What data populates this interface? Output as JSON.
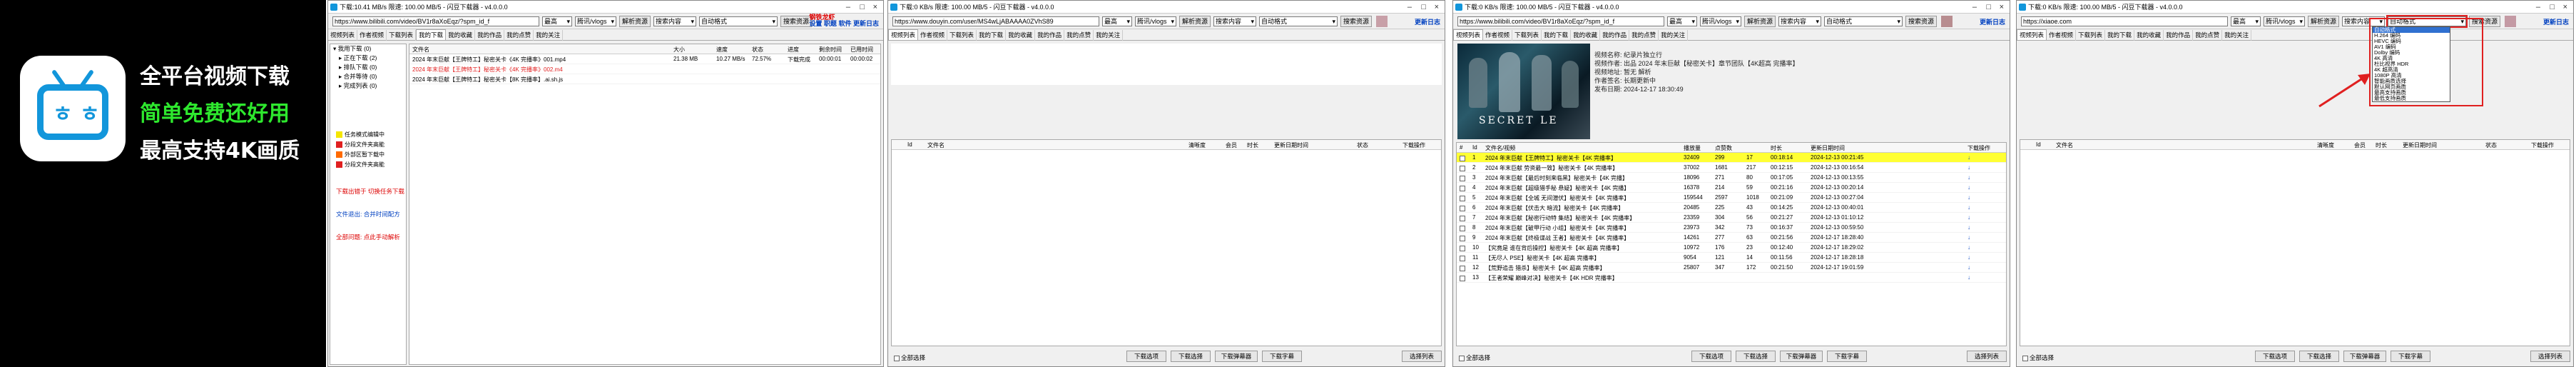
{
  "promo": {
    "line1": "全平台视频下载",
    "line2": "简单免费还好用",
    "line3": "最高支持4K画质",
    "colors": {
      "bg": "#000000",
      "white": "#ffffff",
      "green": "#2ee82e",
      "logo_blue": "#1296db"
    }
  },
  "app": {
    "title": "下载:10.41 MB/s 限速: 100.00 MB/5 - 闪豆下载器 - v4.0.0.0",
    "title_idle": "下载:0 KB/s 限速: 100.00 MB/5 - 闪豆下载器 - v4.0.0.0",
    "url_b": "https://www.bilibili.com/video/BV1r8aXoEqz/?spm_id_f",
    "url_d": "https://www.douyin.com/user/MS4wLjABAAAA0ZVhS89",
    "url_c": "https://www.bilibili.com/video/BV1r8aXoEqz/?spm_id_f",
    "url_e": "https://xiaoe.com",
    "sel_quality": "最高",
    "sel_mode": "腾讯/vlogs",
    "btn_parse": "解析资源",
    "sel_site": "搜索内容",
    "sel_format": "自动格式",
    "btn_search": "搜索资源",
    "user_name": "钢铁龙虾",
    "links": [
      "设置",
      "职题",
      "软件",
      "更新日志"
    ],
    "tabs": [
      "视频列表",
      "作者视频",
      "下载列表",
      "我的下载",
      "我的收藏",
      "我的作品",
      "我的点赞",
      "我的关注"
    ]
  },
  "win_a": {
    "tree": [
      "我用下载 (0)",
      "正在下载 (2)",
      "排队下载 (0)",
      "合并等待 (0)",
      "完成列表 (0)"
    ],
    "headers": [
      "文件名",
      "大小",
      "速度",
      "状态",
      "进度",
      "剩余时间",
      "已用时间"
    ],
    "rows": [
      {
        "name": "2024 年末巨献【王牌特工】秘密关卡《4K 完播率》001.mp4",
        "size": "21.38 MB",
        "speed": "10.27 MB/s",
        "progress": "72.57%",
        "status": "下载完成",
        "remain": "00:00:01",
        "used": "00:00:02"
      },
      {
        "name": "2024 年末巨献【王牌特工】秘密关卡《4K 完播率》002.m4",
        "size": "",
        "speed": "",
        "progress": "",
        "status": "",
        "remain": "",
        "used": ""
      },
      {
        "name": "2024 年末巨献【王牌特工】秘密关卡【8K 完播率】.ai.sh.js",
        "size": "",
        "speed": "",
        "progress": "",
        "status": "",
        "remain": "",
        "used": ""
      }
    ],
    "legend": [
      {
        "label": "任务模式编辑中",
        "color": "#f5e600"
      },
      {
        "label": "分段文件夹高能",
        "color": "#e02020"
      },
      {
        "label": "外部区暂下载中",
        "color": "#ff6a00"
      },
      {
        "label": "分段文件夹高能",
        "color": "#e02020"
      }
    ],
    "notes": [
      "下载出错于 切换任务下载",
      "文件退出: 合并时间配方",
      "全部问题: 点此手动解析"
    ]
  },
  "win_b": {
    "headers": [
      "Id",
      "文件名",
      "清晰度",
      "会员",
      "时长",
      "更新日期时间",
      "状态",
      "下载操作"
    ],
    "select_all": "全部选择",
    "buttons": [
      "下载选项",
      "下载选择",
      "下载弹幕器",
      "下载字幕",
      "选择列表"
    ]
  },
  "win_c": {
    "info": [
      "视频名称: 纪录片独立行",
      "视频作者: 出品 2024 年末巨献【秘密关卡】章节团队【4K超高 完播率】",
      "视频地址: 暂无 解析",
      "作者签名: 长期更新中",
      "发布日期: 2024-12-17 18:30:49"
    ],
    "poster_text": "SECRET LE",
    "headers": [
      "#",
      "Id",
      "文件名/视频",
      "播放量",
      "点赞数",
      "时长",
      "更新日期时间",
      "下载操作"
    ],
    "rows": [
      {
        "id": "1",
        "name": "2024 年末巨献【王牌特工】秘密关卡【4K 完播率】",
        "plays": "32409",
        "likes": "299",
        "x": "17",
        "dur": "00:18:14",
        "date": "2024-12-13 00:21:45",
        "sel": true
      },
      {
        "id": "2",
        "name": "2024 年末巨献 劳资最一致】秘密关卡【4K 完播率】",
        "plays": "37002",
        "likes": "1681",
        "x": "217",
        "dur": "00:12:15",
        "date": "2024-12-13 00:16:54",
        "sel": false
      },
      {
        "id": "3",
        "name": "2024 年末巨献【最后时刻来临黑】秘密关卡【4K 完播】",
        "plays": "18096",
        "likes": "271",
        "x": "80",
        "dur": "00:17:05",
        "date": "2024-12-13 00:13:55",
        "sel": false
      },
      {
        "id": "4",
        "name": "2024 年末巨献【超级猎手秘 悬疑】秘密关卡【4K 完播】",
        "plays": "16378",
        "likes": "214",
        "x": "59",
        "dur": "00:21:16",
        "date": "2024-12-13 00:20:14",
        "sel": false
      },
      {
        "id": "5",
        "name": "2024 年末巨献【全城 无间潜伏】秘密关卡【4K 完播率】",
        "plays": "159544",
        "likes": "2597",
        "x": "1018",
        "dur": "00:21:09",
        "date": "2024-12-13 00:27:04",
        "sel": false
      },
      {
        "id": "6",
        "name": "2024 年末巨献【伏击大 暗流】秘密关卡【4K 完播率】",
        "plays": "20485",
        "likes": "225",
        "x": "43",
        "dur": "00:14:25",
        "date": "2024-12-13 00:40:01",
        "sel": false
      },
      {
        "id": "7",
        "name": "2024 年末巨献【秘密行动特 集结】秘密关卡【4K 完播率】",
        "plays": "23359",
        "likes": "304",
        "x": "56",
        "dur": "00:21:27",
        "date": "2024-12-13 01:10:12",
        "sel": false
      },
      {
        "id": "8",
        "name": "2024 年末巨献【破甲行动 小组】秘密关卡【4K 完播率】",
        "plays": "23973",
        "likes": "342",
        "x": "73",
        "dur": "00:16:37",
        "date": "2024-12-13 00:59:50",
        "sel": false
      },
      {
        "id": "9",
        "name": "2024 年末巨献【终极谍战 王者】秘密关卡【4K 完播率】",
        "plays": "14261",
        "likes": "277",
        "x": "63",
        "dur": "00:21:56",
        "date": "2024-12-17 18:28:40",
        "sel": false
      },
      {
        "id": "10",
        "name": "【究竟是 谁在背后操控】秘密关卡【4K 超高 完播率】",
        "plays": "10972",
        "likes": "176",
        "x": "23",
        "dur": "00:12:40",
        "date": "2024-12-17 18:29:02",
        "sel": false
      },
      {
        "id": "11",
        "name": "【无尽人 PSE】秘密关卡【4K 超高 完播率】",
        "plays": "9054",
        "likes": "121",
        "x": "14",
        "dur": "00:11:56",
        "date": "2024-12-17 18:28:18",
        "sel": false
      },
      {
        "id": "12",
        "name": "【荒野追击 猎杀】秘密关卡【4K 超高 完播率】",
        "plays": "25807",
        "likes": "347",
        "x": "172",
        "dur": "00:21:50",
        "date": "2024-12-17 19:01:59",
        "sel": false
      },
      {
        "id": "13",
        "name": "【王者荣耀 巅峰对决】秘密关卡【4K HDR 完播率】",
        "plays": "",
        "likes": "",
        "x": "",
        "dur": "",
        "date": "",
        "sel": false
      }
    ],
    "select_all": "全部选择",
    "buttons": [
      "下载选项",
      "下载选择",
      "下载弹幕器",
      "下载字幕",
      "选择列表"
    ]
  },
  "win_d": {
    "dropdown_items": [
      "自动格式",
      "H.264 编码",
      "HEVC 编码",
      "AV1 编码",
      "Dolby 编码",
      "4K 高清",
      "杜比视界 HDR",
      "4K 超高清",
      "1080P 高清",
      "智能画质选择",
      "默认网页画质",
      "最高支持画质",
      "最低支持画质"
    ],
    "dropdown_selected": "自动格式",
    "highlight_color": "#e02020"
  }
}
